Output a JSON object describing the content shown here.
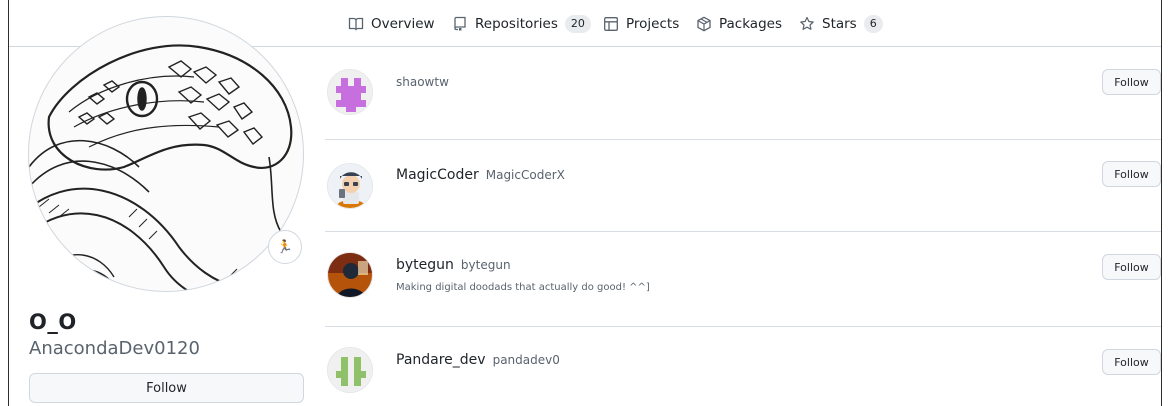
{
  "nav": {
    "overview": {
      "label": "Overview",
      "icon": "book-icon"
    },
    "repositories": {
      "label": "Repositories",
      "count": "20",
      "icon": "repo-icon"
    },
    "projects": {
      "label": "Projects",
      "icon": "table-icon"
    },
    "packages": {
      "label": "Packages",
      "icon": "package-icon"
    },
    "stars": {
      "label": "Stars",
      "count": "6",
      "icon": "star-icon"
    }
  },
  "profile": {
    "name": "O_O",
    "login": "AnacondaDev0120",
    "follow_label": "Follow",
    "status_icon": "runner-emoji-icon"
  },
  "users": [
    {
      "display_name": "shaowtw",
      "login": "",
      "bio": "",
      "follow_label": "Follow",
      "avatar": "identicon-purple"
    },
    {
      "display_name": "MagicCoder",
      "login": "MagicCoderX",
      "bio": "",
      "follow_label": "Follow",
      "avatar": "cartoon-coder"
    },
    {
      "display_name": "bytegun",
      "login": "bytegun",
      "bio": "Making digital doodads that actually do good! ^^]",
      "follow_label": "Follow",
      "avatar": "person-photo"
    },
    {
      "display_name": "Pandare_dev",
      "login": "pandadev0",
      "bio": "",
      "follow_label": "Follow",
      "avatar": "identicon-green"
    }
  ],
  "colors": {
    "accent_count_bg": "#e9ecef",
    "button_bg": "#f6f8fa",
    "border": "#d0d7de",
    "identicon_purple": "#c86fe0",
    "identicon_green": "#8fc06a"
  }
}
